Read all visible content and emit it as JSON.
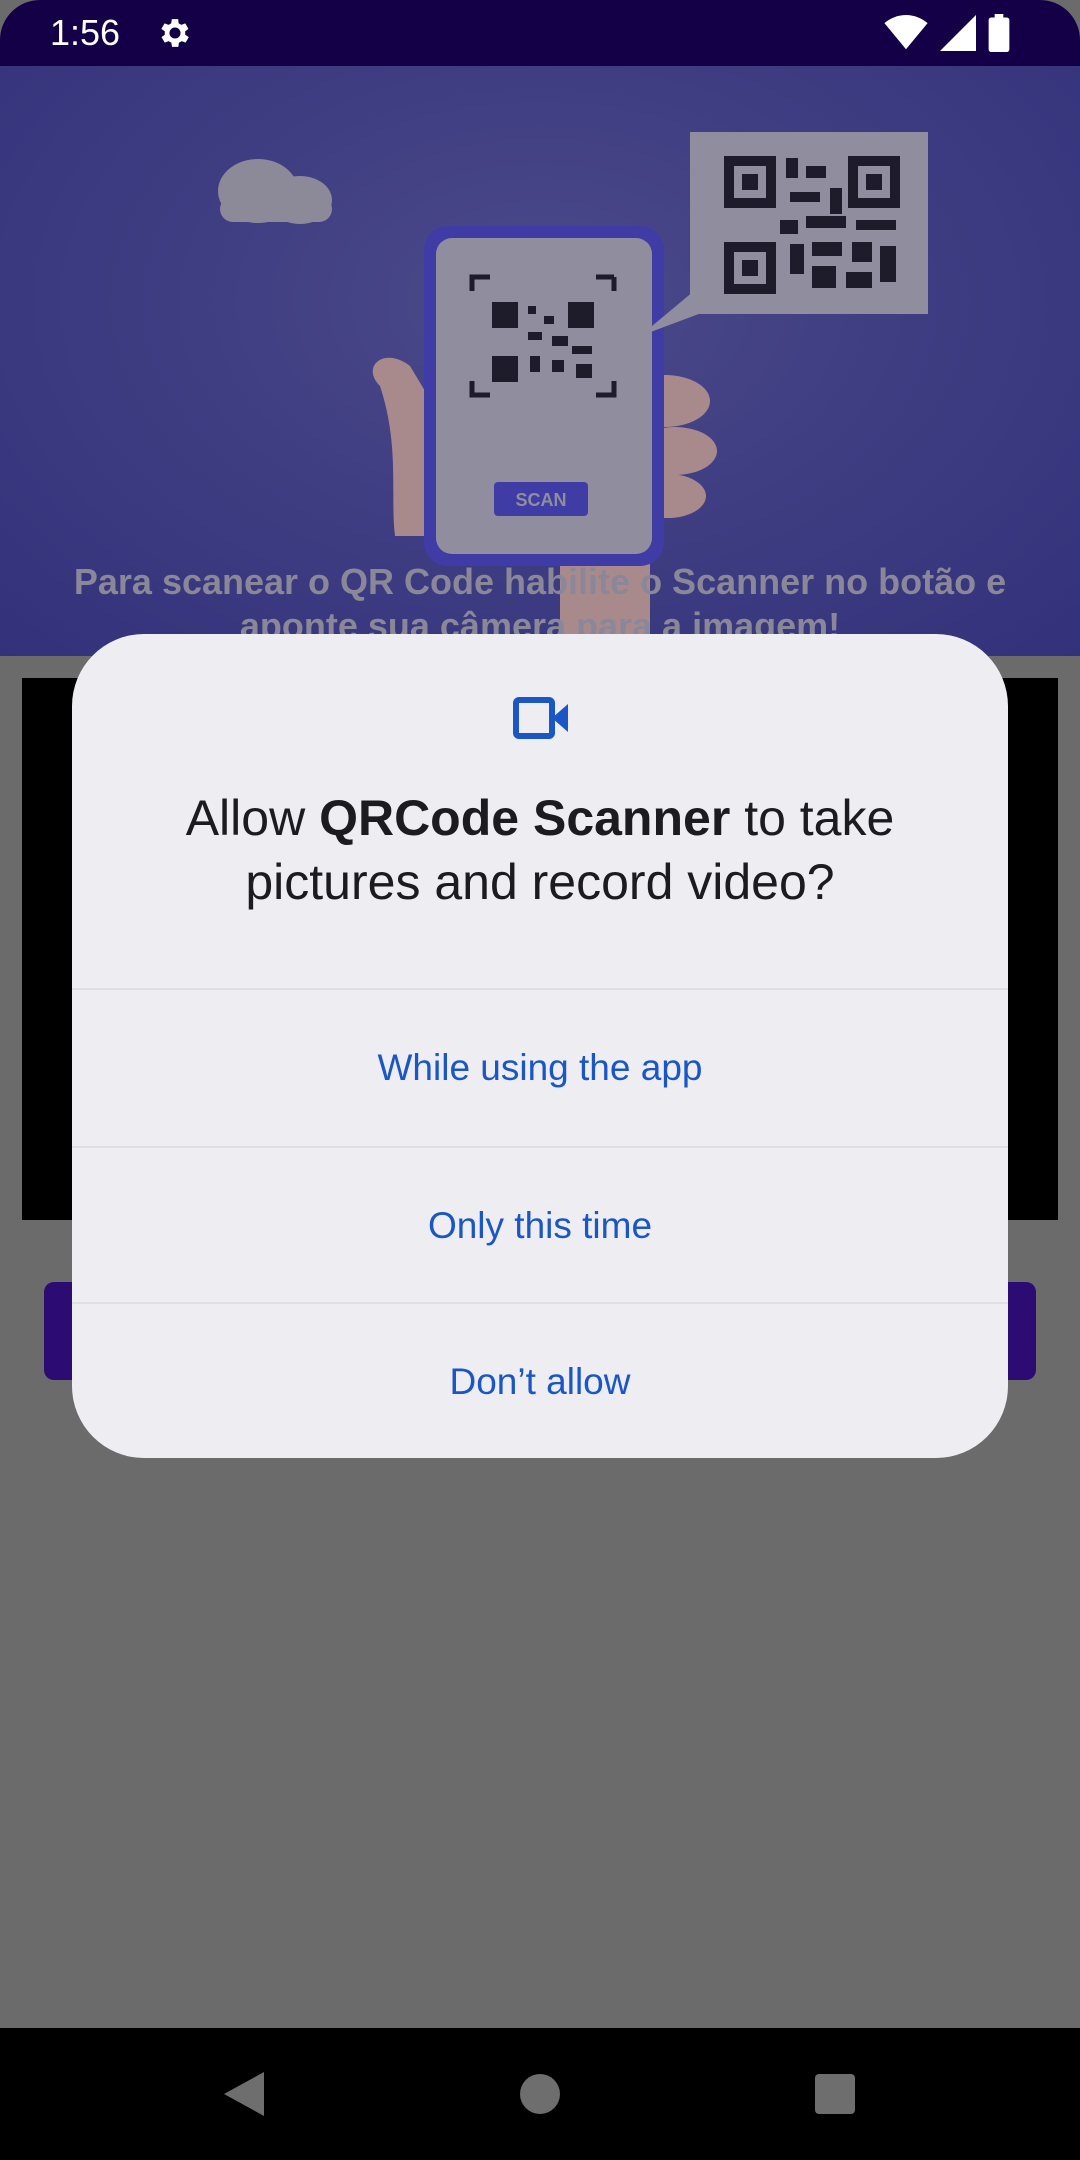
{
  "status_bar": {
    "time": "1:56",
    "icons": [
      "gear-icon",
      "wifi-icon",
      "signal-icon",
      "battery-icon"
    ]
  },
  "banner": {
    "text": "Para scanear o QR Code habilite o Scanner no botão e aponte sua câmera para a imagem!",
    "phone_scan_label": "SCAN"
  },
  "dialog": {
    "icon": "videocam-icon",
    "title_prefix": "Allow ",
    "app_name": "QRCode Scanner",
    "title_suffix": " to take pictures and record video?",
    "options": [
      {
        "label": "While using the app"
      },
      {
        "label": "Only this time"
      },
      {
        "label": "Don’t allow"
      }
    ]
  },
  "colors": {
    "accent": "#1a56c4",
    "status_bar": "#140046",
    "scan_button": "#2c0b73",
    "dialog_bg": "#eeedf1"
  },
  "nav_bar": {
    "icons": [
      "back-icon",
      "home-icon",
      "recents-icon"
    ]
  }
}
